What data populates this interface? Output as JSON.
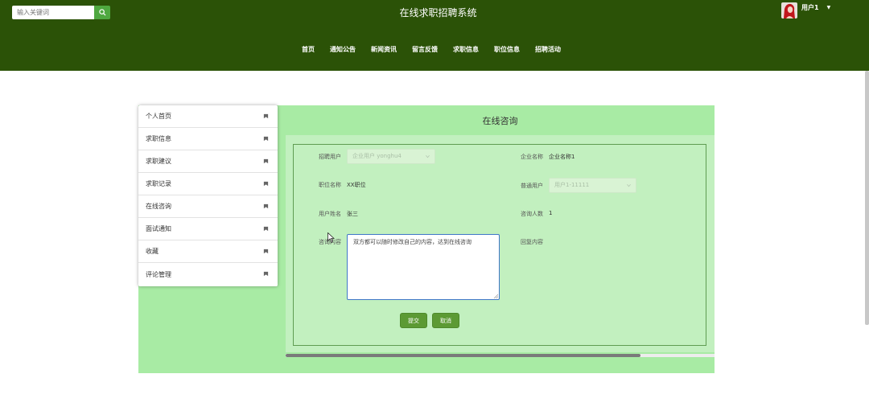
{
  "header": {
    "search_placeholder": "输入关键词",
    "search_icon": "search-icon",
    "site_title": "在线求职招聘系统",
    "user_name": "用户1",
    "user_caret": "▼",
    "nav": [
      "首页",
      "通知公告",
      "新闻资讯",
      "留言反馈",
      "求职信息",
      "职位信息",
      "招聘活动"
    ]
  },
  "sidebar": {
    "items": [
      {
        "label": "个人首页",
        "icon": "bookmark-icon"
      },
      {
        "label": "求职信息",
        "icon": "bookmark-icon"
      },
      {
        "label": "求职建议",
        "icon": "bookmark-icon"
      },
      {
        "label": "求职记录",
        "icon": "bookmark-icon"
      },
      {
        "label": "在线咨询",
        "icon": "bookmark-icon"
      },
      {
        "label": "面试通知",
        "icon": "bookmark-icon"
      },
      {
        "label": "收藏",
        "icon": "bookmark-icon"
      },
      {
        "label": "评论管理",
        "icon": "bookmark-icon"
      }
    ]
  },
  "panel": {
    "title": "在线咨询",
    "form": {
      "company_user_label": "招聘用户",
      "company_user_value": "企业用户 yonghu4",
      "company_name_label": "企业名称",
      "company_name_value": "企业名称1",
      "position_label": "职位名称",
      "position_value": "XX职位",
      "normal_user_label": "普通用户",
      "normal_user_value": "用户1-11111",
      "user_name_label": "用户姓名",
      "user_name_value": "张三",
      "consult_count_label": "咨询人数",
      "consult_count_value": "1",
      "consult_content_label": "咨询内容",
      "consult_content_value": "双方都可以随时修改自己的内容，达到在线咨询",
      "reply_content_label": "回复内容"
    },
    "submit_label": "提交",
    "cancel_label": "取消"
  },
  "colors": {
    "header_bg": "#2b5207",
    "content_bg": "#a8eba4",
    "panel_body": "#c2f0bf",
    "button": "#5c9a34"
  }
}
